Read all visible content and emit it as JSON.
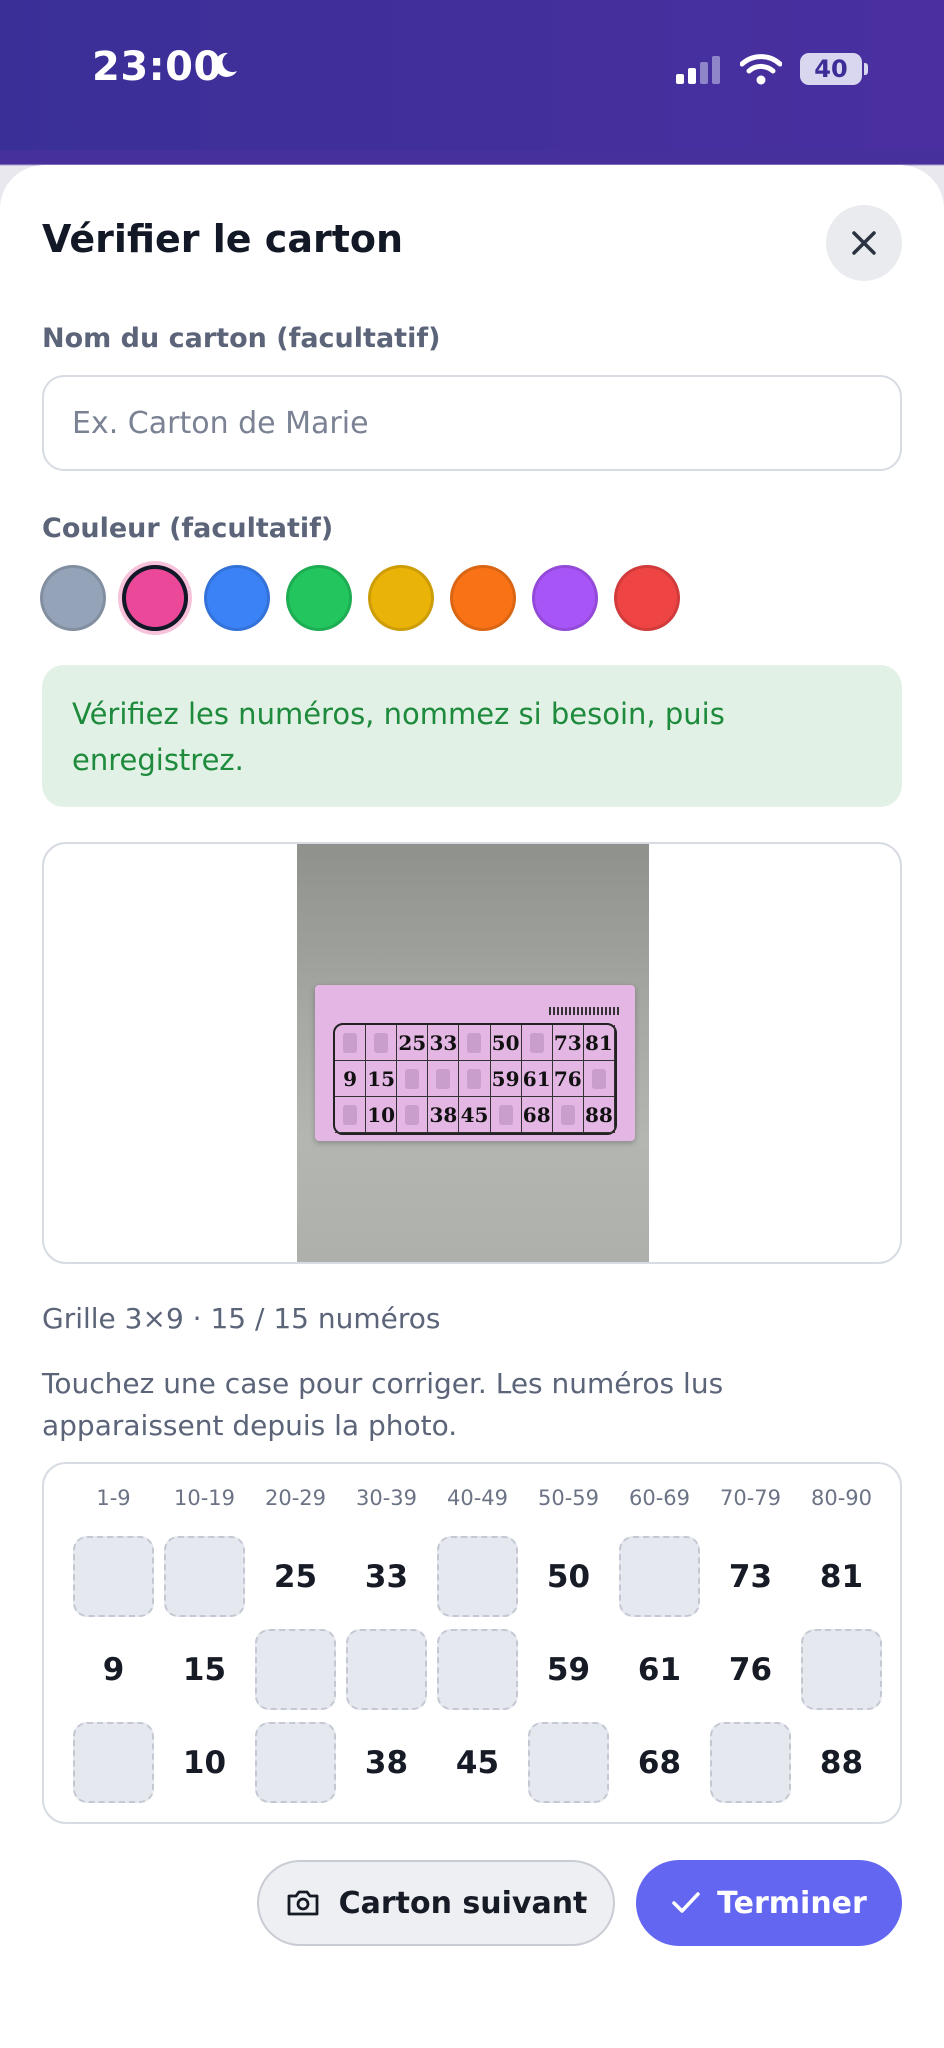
{
  "status": {
    "time": "23:00",
    "battery": "40"
  },
  "sheet": {
    "title": "Vérifier le carton",
    "name_label": "Nom du carton (facultatif)",
    "name_placeholder": "Ex. Carton de Marie",
    "name_value": "",
    "color_label": "Couleur (facultatif)",
    "colors": [
      "#94a3b8",
      "#ec4899",
      "#3b82f6",
      "#22c55e",
      "#eab308",
      "#f97316",
      "#a855f7",
      "#ef4444"
    ],
    "selected_color": "#ec4899",
    "hint": "Vérifiez les numéros, nommez si besoin, puis enregistrez.",
    "photo_card": {
      "rows": [
        [
          "",
          "",
          "25",
          "33",
          "",
          "50",
          "",
          "73",
          "81"
        ],
        [
          "9",
          "15",
          "",
          "",
          "",
          "59",
          "61",
          "76",
          ""
        ],
        [
          "",
          "10",
          "",
          "38",
          "45",
          "",
          "68",
          "",
          "88"
        ]
      ]
    },
    "grid_meta": "Grille 3×9 · 15 / 15 numéros",
    "instructions": "Touchez une case pour corriger. Les numéros lus apparaissent depuis la photo.",
    "columns": [
      "1-9",
      "10-19",
      "20-29",
      "30-39",
      "40-49",
      "50-59",
      "60-69",
      "70-79",
      "80-90"
    ],
    "grid": [
      [
        "",
        "",
        "25",
        "33",
        "",
        "50",
        "",
        "73",
        "81"
      ],
      [
        "9",
        "15",
        "",
        "",
        "",
        "59",
        "61",
        "76",
        ""
      ],
      [
        "",
        "10",
        "",
        "38",
        "45",
        "",
        "68",
        "",
        "88"
      ]
    ],
    "next_button": "Carton suivant",
    "done_button": "Terminer"
  }
}
